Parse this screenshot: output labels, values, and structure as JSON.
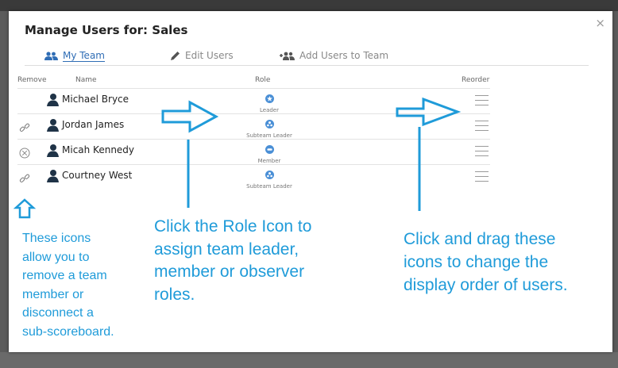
{
  "dialog": {
    "title": "Manage Users for: Sales",
    "close_label": "×"
  },
  "tabs": [
    {
      "label": "My Team",
      "icon": "users-icon",
      "active": true
    },
    {
      "label": "Edit Users",
      "icon": "pencil-icon",
      "active": false
    },
    {
      "label": "Add Users to Team",
      "icon": "add-users-icon",
      "active": false
    }
  ],
  "columns": {
    "remove": "Remove",
    "name": "Name",
    "role": "Role",
    "reorder": "Reorder"
  },
  "rows": [
    {
      "name": "Michael Bryce",
      "role": "Leader",
      "remove_icon": "none"
    },
    {
      "name": "Jordan James",
      "role": "Subteam Leader",
      "remove_icon": "unlink-icon"
    },
    {
      "name": "Micah Kennedy",
      "role": "Member",
      "remove_icon": "remove-circle-icon"
    },
    {
      "name": "Courtney West",
      "role": "Subteam Leader",
      "remove_icon": "unlink-icon"
    }
  ],
  "annotations": {
    "left": [
      "These icons",
      "allow you to",
      "remove a team",
      "member or",
      "disconnect a",
      "sub-scoreboard."
    ],
    "middle": [
      "Click the Role Icon to",
      "assign team leader,",
      "member or observer",
      "roles."
    ],
    "right": [
      "Click and drag these",
      "icons to change the",
      "display order of users."
    ]
  },
  "colors": {
    "accent": "#2f6db5",
    "annotation": "#1f9bd9",
    "role_icon": "#4a8fd6"
  }
}
